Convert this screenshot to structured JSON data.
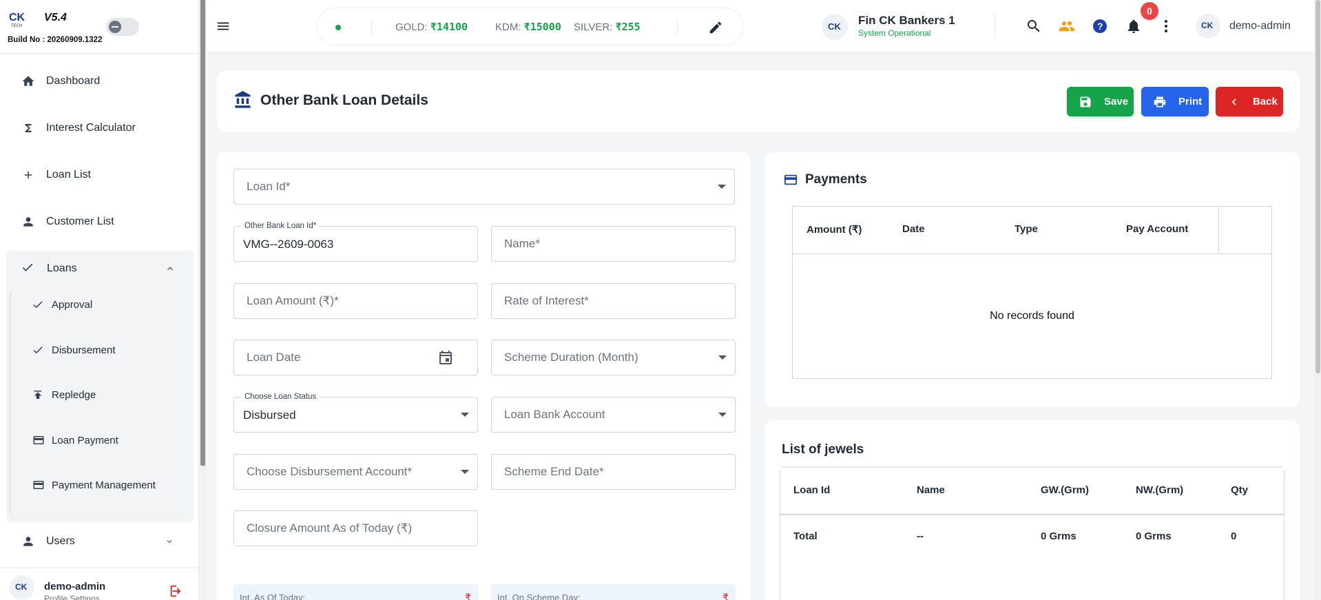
{
  "app": {
    "version": "V5.4",
    "build": "Build No : 20260909.1322"
  },
  "sidebar": {
    "items": [
      {
        "label": "Dashboard",
        "icon": "home-icon"
      },
      {
        "label": "Interest Calculator",
        "icon": "sigma-icon"
      },
      {
        "label": "Loan List",
        "icon": "plus-icon"
      },
      {
        "label": "Customer List",
        "icon": "person-icon"
      }
    ],
    "loans": {
      "label": "Loans",
      "subitems": [
        {
          "label": "Approval",
          "icon": "check-icon"
        },
        {
          "label": "Disbursement",
          "icon": "check-icon"
        },
        {
          "label": "Repledge",
          "icon": "upload-icon"
        },
        {
          "label": "Loan Payment",
          "icon": "card-icon"
        },
        {
          "label": "Payment Management",
          "icon": "card-icon"
        }
      ]
    },
    "users": {
      "label": "Users"
    },
    "footer": {
      "user": "demo-admin",
      "profile": "Profile Settings"
    }
  },
  "topbar": {
    "rates": [
      {
        "label": "GOLD:",
        "value": "₹14100"
      },
      {
        "label": "KDM:",
        "value": "₹15000"
      },
      {
        "label": "SILVER:",
        "value": "₹255"
      }
    ],
    "org_name": "Fin CK Bankers 1",
    "org_status": "System Operational",
    "notification_count": "0",
    "user": "demo-admin"
  },
  "page": {
    "title": "Other Bank Loan Details",
    "buttons": {
      "save": "Save",
      "print": "Print",
      "back": "Back"
    }
  },
  "form": {
    "loan_id": {
      "placeholder": "Loan Id*"
    },
    "other_bank_loan_id": {
      "label": "Other Bank Loan Id*",
      "value": "VMG--2609-0063"
    },
    "name": {
      "placeholder": "Name*"
    },
    "loan_amount": {
      "placeholder": "Loan Amount (₹)*"
    },
    "rate_of_interest": {
      "placeholder": "Rate of Interest*"
    },
    "loan_date": {
      "placeholder": "Loan Date"
    },
    "scheme_duration": {
      "placeholder": "Scheme Duration (Month)"
    },
    "loan_status": {
      "label": "Choose Loan Status",
      "value": "Disbursed"
    },
    "loan_bank_account": {
      "placeholder": "Loan Bank Account"
    },
    "disbursement_account": {
      "placeholder": "Choose Disbursement Account*"
    },
    "scheme_end_date": {
      "placeholder": "Scheme End Date*"
    },
    "closure_amount": {
      "placeholder": "Closure Amount As of Today (₹)"
    },
    "int_as_of_today": {
      "label": "Int. As Of Today:",
      "value": "₹"
    },
    "int_on_scheme_day": {
      "label": "Int. On Scheme Day:",
      "value": "₹"
    }
  },
  "payments": {
    "title": "Payments",
    "columns": [
      "Amount (₹)",
      "Date",
      "Type",
      "Pay Account"
    ],
    "empty": "No records found"
  },
  "jewels": {
    "title": "List of jewels",
    "columns": [
      "Loan Id",
      "Name",
      "GW.(Grm)",
      "NW.(Grm)",
      "Qty"
    ],
    "total_row": [
      "Total",
      "--",
      "0 Grms",
      "0 Grms",
      "0"
    ]
  },
  "colors": {
    "save": "#16a34a",
    "print": "#2563eb",
    "back": "#dc2626",
    "rate_value": "#16a34a",
    "badge": "#ef4444"
  }
}
